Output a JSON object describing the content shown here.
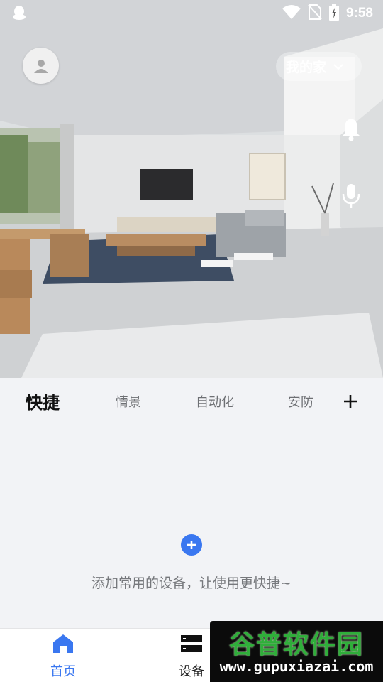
{
  "status_bar": {
    "time": "9:58",
    "icons": [
      "qq-icon",
      "wifi-icon",
      "no-sim-icon",
      "battery-charging-icon"
    ]
  },
  "header": {
    "home_name": "我的家",
    "icons": [
      "avatar-icon",
      "bell-icon",
      "microphone-icon",
      "chevron-down-icon"
    ]
  },
  "tabs": [
    {
      "label": "快捷",
      "active": true
    },
    {
      "label": "情景",
      "active": false
    },
    {
      "label": "自动化",
      "active": false
    },
    {
      "label": "安防",
      "active": false
    }
  ],
  "empty_state": {
    "message": "添加常用的设备，让使用更快捷~"
  },
  "bottom_nav": [
    {
      "label": "首页",
      "icon": "home-icon",
      "active": true
    },
    {
      "label": "设备",
      "icon": "devices-icon",
      "active": false
    }
  ],
  "watermark": {
    "title": "谷普软件园",
    "url": "www.gupuxiazai.com"
  },
  "colors": {
    "accent": "#3a77f0",
    "background": "#f2f3f6",
    "watermark_green": "#2fae3a"
  }
}
